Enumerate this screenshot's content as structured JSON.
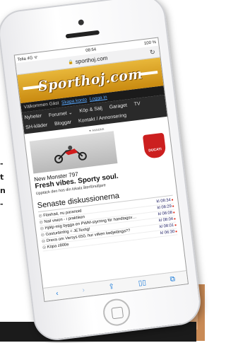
{
  "side_text": [
    "-",
    "t",
    "n",
    "-"
  ],
  "status": {
    "carrier": "Telia 4G ᯤ",
    "time": "08:54",
    "battery": "100 %"
  },
  "url": "sporthoj.com",
  "logo": "Sporthoj.com",
  "welcome": {
    "text": "Välkommen Gäst",
    "register": "Skapa konto",
    "login": "Logga in"
  },
  "nav": [
    [
      "Nyheter",
      "Forumet ⌄",
      "Köp & Sälj",
      "Garaget",
      "TV"
    ],
    [
      "SH-kläder",
      "Bloggar",
      "Kontakt / Annonsering"
    ]
  ],
  "ad": {
    "label": "▼ ANNONS",
    "title": "New Monster 797",
    "slogan": "Fresh vibes. Sporty soul.",
    "sub": "Upptäck den hos din lokala återförsäljare",
    "brand": "DUCATI"
  },
  "section_title": "Senaste diskussionerna",
  "discussions": [
    {
      "title": "Flashad, nu paranoid",
      "time": "kl 08:34"
    },
    {
      "title": "Nail vision - i praktiken",
      "time": "kl 08:29"
    },
    {
      "title": "Hjälp-mig bygga en PWM-styrning för handtagsvär...",
      "time": "kl 08:08"
    },
    {
      "title": "Gasturbinfrig = JETextig!",
      "time": "kl 08:04"
    },
    {
      "title": "Dreva om Versys 650, hur vilken kedjelänga??",
      "time": "kl 08:01"
    },
    {
      "title": "Köpa z800e",
      "time": "kl 06:30"
    }
  ],
  "toolbar": [
    "‹",
    "›",
    "⇪",
    "▯▯",
    "⧉"
  ]
}
